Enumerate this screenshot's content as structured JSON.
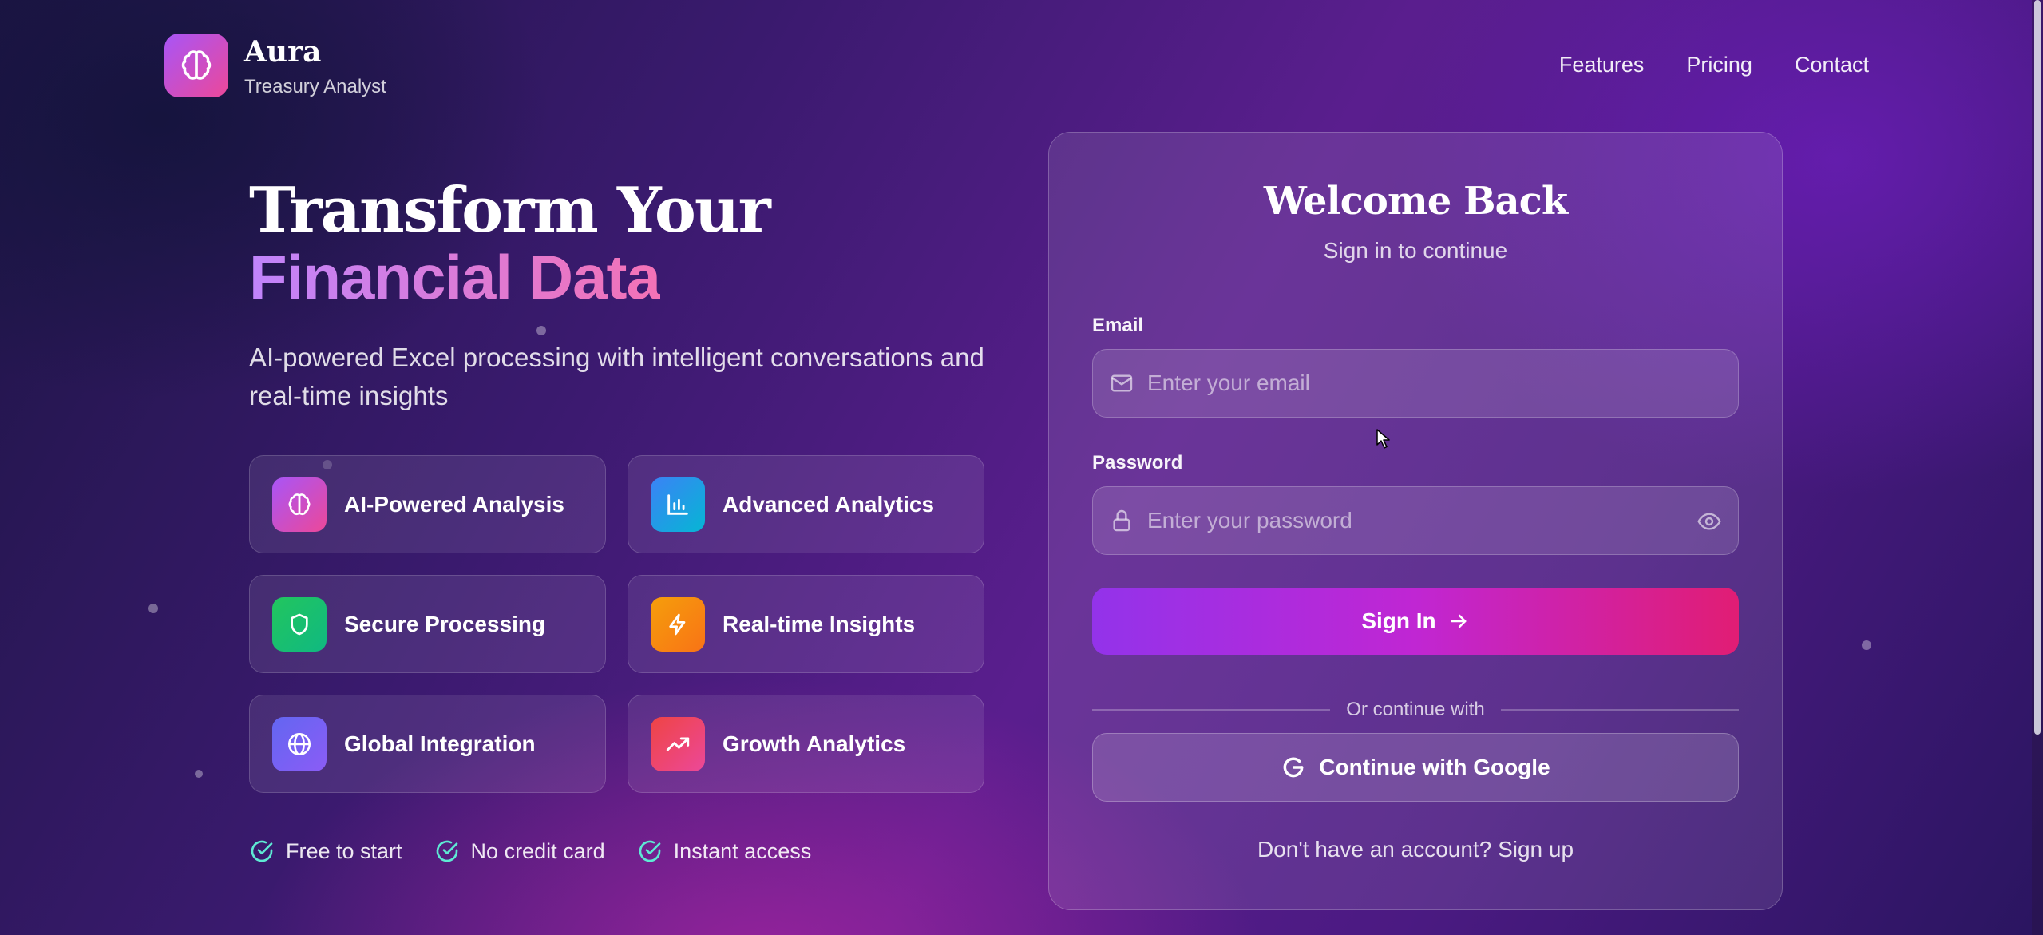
{
  "header": {
    "brand_name": "Aura",
    "brand_subtitle": "Treasury Analyst",
    "nav": [
      "Features",
      "Pricing",
      "Contact"
    ]
  },
  "hero": {
    "title_line1": "Transform Your",
    "title_line2": "Financial Data",
    "description": "AI-powered Excel processing with intelligent conversations and real-time insights"
  },
  "features": [
    {
      "label": "AI-Powered Analysis",
      "icon": "brain-icon",
      "color_from": "#a855f7",
      "color_to": "#ec4899"
    },
    {
      "label": "Advanced Analytics",
      "icon": "bar-chart-icon",
      "color_from": "#3b82f6",
      "color_to": "#06b6d4"
    },
    {
      "label": "Secure Processing",
      "icon": "shield-icon",
      "color_from": "#22c55e",
      "color_to": "#10b981"
    },
    {
      "label": "Real-time Insights",
      "icon": "lightning-icon",
      "color_from": "#f59e0b",
      "color_to": "#f97316"
    },
    {
      "label": "Global Integration",
      "icon": "globe-icon",
      "color_from": "#6366f1",
      "color_to": "#8b5cf6"
    },
    {
      "label": "Growth Analytics",
      "icon": "trending-up-icon",
      "color_from": "#ef4444",
      "color_to": "#ec4899"
    }
  ],
  "perks": [
    "Free to start",
    "No credit card",
    "Instant access"
  ],
  "login": {
    "title": "Welcome Back",
    "subtitle": "Sign in to continue",
    "email_label": "Email",
    "email_placeholder": "Enter your email",
    "email_value": "",
    "password_label": "Password",
    "password_placeholder": "Enter your password",
    "password_value": "",
    "signin_label": "Sign In",
    "divider_text": "Or continue with",
    "google_label": "Continue with Google",
    "signup_prompt": "Don't have an account? Sign up"
  },
  "colors": {
    "accent_purple": "#9333ea",
    "accent_pink": "#e11d74",
    "perk_check": "#5eead4"
  }
}
